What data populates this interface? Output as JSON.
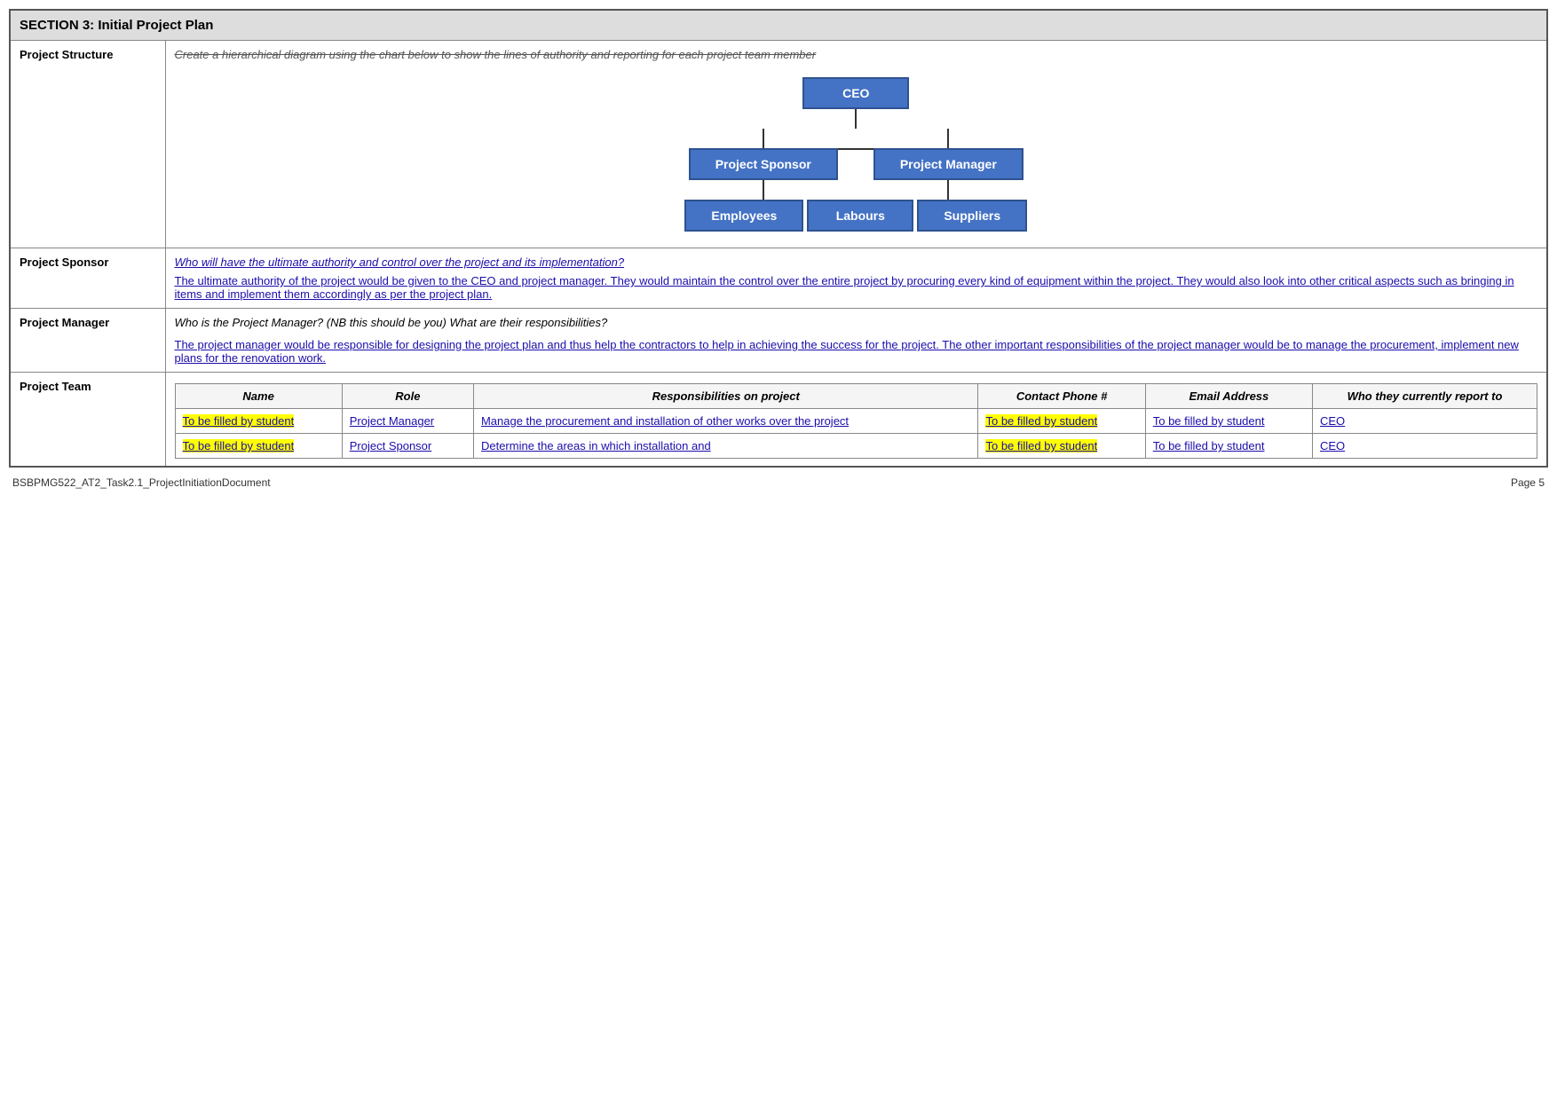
{
  "section_header": "SECTION 3: Initial Project Plan",
  "rows": {
    "project_structure": {
      "label": "Project Structure",
      "instruction_strikethrough": "Create a hierarchical diagram using the chart below to show the lines of authority and reporting for each project team member",
      "org_chart": {
        "ceo": "CEO",
        "level2": [
          "Project Sponsor",
          "Project Manager"
        ],
        "level3": [
          "Employees",
          "Labours",
          "Suppliers"
        ]
      }
    },
    "project_sponsor": {
      "label": "Project Sponsor",
      "question": "Who will have the ultimate authority and control over the project and its implementation?",
      "answer": "The ultimate authority of the project would be given to the CEO and project manager. They would maintain the control over the entire project by procuring every kind of equipment within the project. They would also look into other critical aspects such as bringing in items and implement them accordingly as per the project plan."
    },
    "project_manager": {
      "label": "Project Manager",
      "question": "Who is the Project Manager? (NB this should be you) What are their responsibilities?",
      "answer": "The project manager would be responsible for designing the project plan and thus help the contractors to help in achieving the success for the project. The other important responsibilities of the project manager would be to manage the procurement, implement new plans for the renovation work."
    },
    "project_team": {
      "label": "Project Team",
      "columns": [
        "Name",
        "Role",
        "Responsibilities on project",
        "Contact Phone #",
        "Email Address",
        "Who they currently report to"
      ],
      "rows": [
        {
          "name": "To be filled by student",
          "role": "Project Manager",
          "responsibilities": "Manage the procurement and installation of other works over the project",
          "contact": "To be filled by student",
          "email": "To be filled by student",
          "reports_to": "CEO"
        },
        {
          "name": "To be filled by student",
          "role": "Project Sponsor",
          "responsibilities": "Determine the areas in which installation and",
          "contact": "To be filled by student",
          "email": "To be filled by student",
          "reports_to": "CEO"
        }
      ]
    }
  },
  "footer": {
    "left": "BSBPMG522_AT2_Task2.1_ProjectInitiationDocument",
    "right": "Page 5"
  }
}
